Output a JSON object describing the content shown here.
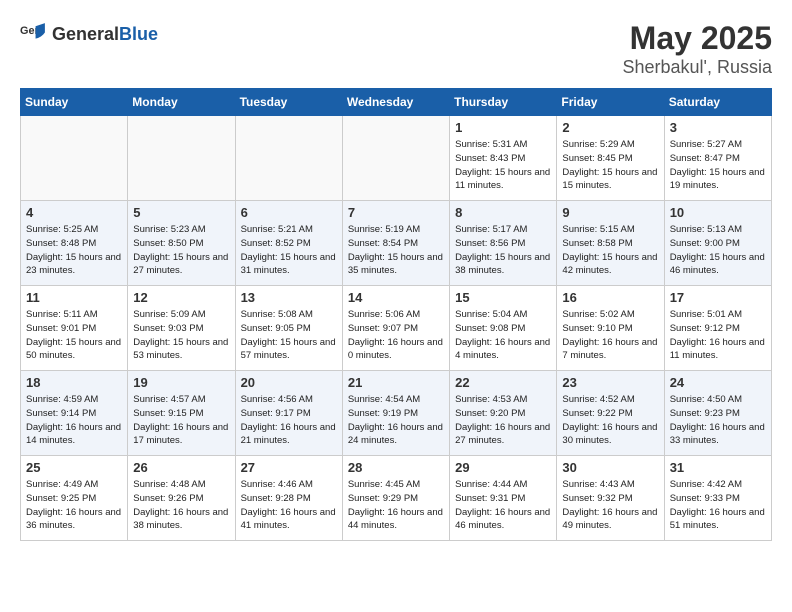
{
  "header": {
    "logo_general": "General",
    "logo_blue": "Blue",
    "month": "May 2025",
    "location": "Sherbakul', Russia"
  },
  "days_of_week": [
    "Sunday",
    "Monday",
    "Tuesday",
    "Wednesday",
    "Thursday",
    "Friday",
    "Saturday"
  ],
  "weeks": [
    [
      {
        "day": "",
        "sunrise": "",
        "sunset": "",
        "daylight": ""
      },
      {
        "day": "",
        "sunrise": "",
        "sunset": "",
        "daylight": ""
      },
      {
        "day": "",
        "sunrise": "",
        "sunset": "",
        "daylight": ""
      },
      {
        "day": "",
        "sunrise": "",
        "sunset": "",
        "daylight": ""
      },
      {
        "day": "1",
        "sunrise": "Sunrise: 5:31 AM",
        "sunset": "Sunset: 8:43 PM",
        "daylight": "Daylight: 15 hours and 11 minutes."
      },
      {
        "day": "2",
        "sunrise": "Sunrise: 5:29 AM",
        "sunset": "Sunset: 8:45 PM",
        "daylight": "Daylight: 15 hours and 15 minutes."
      },
      {
        "day": "3",
        "sunrise": "Sunrise: 5:27 AM",
        "sunset": "Sunset: 8:47 PM",
        "daylight": "Daylight: 15 hours and 19 minutes."
      }
    ],
    [
      {
        "day": "4",
        "sunrise": "Sunrise: 5:25 AM",
        "sunset": "Sunset: 8:48 PM",
        "daylight": "Daylight: 15 hours and 23 minutes."
      },
      {
        "day": "5",
        "sunrise": "Sunrise: 5:23 AM",
        "sunset": "Sunset: 8:50 PM",
        "daylight": "Daylight: 15 hours and 27 minutes."
      },
      {
        "day": "6",
        "sunrise": "Sunrise: 5:21 AM",
        "sunset": "Sunset: 8:52 PM",
        "daylight": "Daylight: 15 hours and 31 minutes."
      },
      {
        "day": "7",
        "sunrise": "Sunrise: 5:19 AM",
        "sunset": "Sunset: 8:54 PM",
        "daylight": "Daylight: 15 hours and 35 minutes."
      },
      {
        "day": "8",
        "sunrise": "Sunrise: 5:17 AM",
        "sunset": "Sunset: 8:56 PM",
        "daylight": "Daylight: 15 hours and 38 minutes."
      },
      {
        "day": "9",
        "sunrise": "Sunrise: 5:15 AM",
        "sunset": "Sunset: 8:58 PM",
        "daylight": "Daylight: 15 hours and 42 minutes."
      },
      {
        "day": "10",
        "sunrise": "Sunrise: 5:13 AM",
        "sunset": "Sunset: 9:00 PM",
        "daylight": "Daylight: 15 hours and 46 minutes."
      }
    ],
    [
      {
        "day": "11",
        "sunrise": "Sunrise: 5:11 AM",
        "sunset": "Sunset: 9:01 PM",
        "daylight": "Daylight: 15 hours and 50 minutes."
      },
      {
        "day": "12",
        "sunrise": "Sunrise: 5:09 AM",
        "sunset": "Sunset: 9:03 PM",
        "daylight": "Daylight: 15 hours and 53 minutes."
      },
      {
        "day": "13",
        "sunrise": "Sunrise: 5:08 AM",
        "sunset": "Sunset: 9:05 PM",
        "daylight": "Daylight: 15 hours and 57 minutes."
      },
      {
        "day": "14",
        "sunrise": "Sunrise: 5:06 AM",
        "sunset": "Sunset: 9:07 PM",
        "daylight": "Daylight: 16 hours and 0 minutes."
      },
      {
        "day": "15",
        "sunrise": "Sunrise: 5:04 AM",
        "sunset": "Sunset: 9:08 PM",
        "daylight": "Daylight: 16 hours and 4 minutes."
      },
      {
        "day": "16",
        "sunrise": "Sunrise: 5:02 AM",
        "sunset": "Sunset: 9:10 PM",
        "daylight": "Daylight: 16 hours and 7 minutes."
      },
      {
        "day": "17",
        "sunrise": "Sunrise: 5:01 AM",
        "sunset": "Sunset: 9:12 PM",
        "daylight": "Daylight: 16 hours and 11 minutes."
      }
    ],
    [
      {
        "day": "18",
        "sunrise": "Sunrise: 4:59 AM",
        "sunset": "Sunset: 9:14 PM",
        "daylight": "Daylight: 16 hours and 14 minutes."
      },
      {
        "day": "19",
        "sunrise": "Sunrise: 4:57 AM",
        "sunset": "Sunset: 9:15 PM",
        "daylight": "Daylight: 16 hours and 17 minutes."
      },
      {
        "day": "20",
        "sunrise": "Sunrise: 4:56 AM",
        "sunset": "Sunset: 9:17 PM",
        "daylight": "Daylight: 16 hours and 21 minutes."
      },
      {
        "day": "21",
        "sunrise": "Sunrise: 4:54 AM",
        "sunset": "Sunset: 9:19 PM",
        "daylight": "Daylight: 16 hours and 24 minutes."
      },
      {
        "day": "22",
        "sunrise": "Sunrise: 4:53 AM",
        "sunset": "Sunset: 9:20 PM",
        "daylight": "Daylight: 16 hours and 27 minutes."
      },
      {
        "day": "23",
        "sunrise": "Sunrise: 4:52 AM",
        "sunset": "Sunset: 9:22 PM",
        "daylight": "Daylight: 16 hours and 30 minutes."
      },
      {
        "day": "24",
        "sunrise": "Sunrise: 4:50 AM",
        "sunset": "Sunset: 9:23 PM",
        "daylight": "Daylight: 16 hours and 33 minutes."
      }
    ],
    [
      {
        "day": "25",
        "sunrise": "Sunrise: 4:49 AM",
        "sunset": "Sunset: 9:25 PM",
        "daylight": "Daylight: 16 hours and 36 minutes."
      },
      {
        "day": "26",
        "sunrise": "Sunrise: 4:48 AM",
        "sunset": "Sunset: 9:26 PM",
        "daylight": "Daylight: 16 hours and 38 minutes."
      },
      {
        "day": "27",
        "sunrise": "Sunrise: 4:46 AM",
        "sunset": "Sunset: 9:28 PM",
        "daylight": "Daylight: 16 hours and 41 minutes."
      },
      {
        "day": "28",
        "sunrise": "Sunrise: 4:45 AM",
        "sunset": "Sunset: 9:29 PM",
        "daylight": "Daylight: 16 hours and 44 minutes."
      },
      {
        "day": "29",
        "sunrise": "Sunrise: 4:44 AM",
        "sunset": "Sunset: 9:31 PM",
        "daylight": "Daylight: 16 hours and 46 minutes."
      },
      {
        "day": "30",
        "sunrise": "Sunrise: 4:43 AM",
        "sunset": "Sunset: 9:32 PM",
        "daylight": "Daylight: 16 hours and 49 minutes."
      },
      {
        "day": "31",
        "sunrise": "Sunrise: 4:42 AM",
        "sunset": "Sunset: 9:33 PM",
        "daylight": "Daylight: 16 hours and 51 minutes."
      }
    ]
  ]
}
